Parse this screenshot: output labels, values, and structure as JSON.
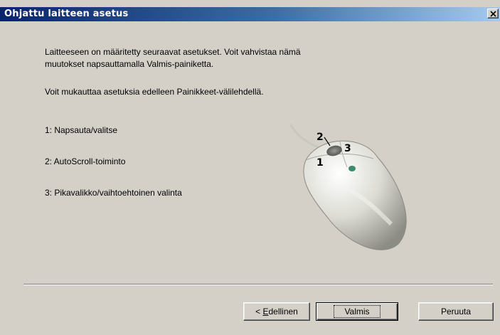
{
  "window": {
    "title": "Ohjattu laitteen asetus",
    "close_icon": "close-icon"
  },
  "content": {
    "intro_line1": "Laitteeseen on määritetty seuraavat asetukset. Voit vahvistaa nämä",
    "intro_line2": "muutokset napsauttamalla Valmis-painiketta.",
    "intro2": "Voit mukauttaa asetuksia edelleen Painikkeet-välilehdellä.",
    "buttons": [
      {
        "label": "1:  Napsauta/valitse"
      },
      {
        "label": "2:  AutoScroll-toiminto"
      },
      {
        "label": "3:  Pikavalikko/vaihtoehtoinen valinta"
      }
    ],
    "mouse_labels": {
      "one": "1",
      "two": "2",
      "three": "3"
    }
  },
  "footer": {
    "back_prefix": "< ",
    "back_accel": "E",
    "back_rest": "dellinen",
    "finish_label": "Valmis",
    "cancel_label": "Peruuta"
  }
}
